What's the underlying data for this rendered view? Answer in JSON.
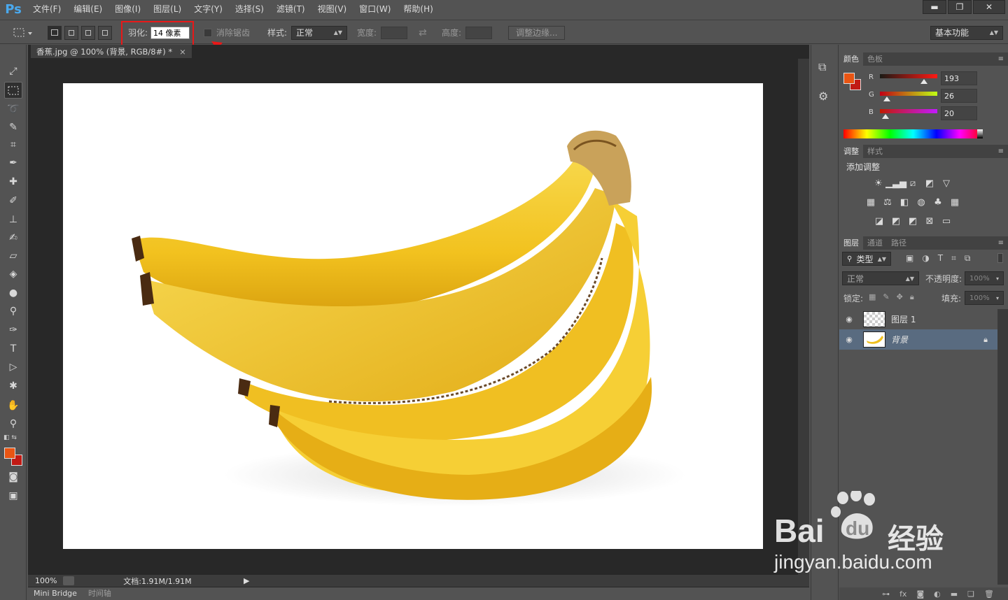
{
  "app": {
    "logo": "Ps"
  },
  "menu": [
    "文件(F)",
    "编辑(E)",
    "图像(I)",
    "图层(L)",
    "文字(Y)",
    "选择(S)",
    "滤镜(T)",
    "视图(V)",
    "窗口(W)",
    "帮助(H)"
  ],
  "window_controls": {
    "minimize": "▬",
    "restore": "❐",
    "close": "✕"
  },
  "options": {
    "feather_label": "羽化:",
    "feather_value": "14 像素",
    "antialias_label": "消除锯齿",
    "style_label": "样式:",
    "style_value": "正常",
    "width_label": "宽度:",
    "height_label": "高度:",
    "refine_edge": "调整边缘...",
    "workspace": "基本功能"
  },
  "document": {
    "tab_title": "香蕉.jpg @ 100% (背景, RGB/8#) *",
    "tab_close": "×",
    "zoom": "100%",
    "doc_info": "文档:1.91M/1.91M"
  },
  "bottom_tabs": [
    "Mini Bridge",
    "时间轴"
  ],
  "color_panel": {
    "tabs": [
      "颜色",
      "色板"
    ],
    "channels": [
      {
        "label": "R",
        "value": "193"
      },
      {
        "label": "G",
        "value": "26"
      },
      {
        "label": "B",
        "value": "20"
      }
    ],
    "foreground": "#c11a14",
    "background": "#e95513"
  },
  "adjust_panel": {
    "tabs": [
      "调整",
      "样式"
    ],
    "title": "添加调整"
  },
  "layers_panel": {
    "tabs": [
      "图层",
      "通道",
      "路径"
    ],
    "filter_label": "类型",
    "blend_mode": "正常",
    "opacity_label": "不透明度:",
    "opacity_value": "100%",
    "lock_label": "锁定:",
    "fill_label": "填充:",
    "fill_value": "100%",
    "layers": [
      {
        "name": "图层 1"
      },
      {
        "name": "背景"
      }
    ]
  },
  "watermark": {
    "brand": "Bai",
    "brand2": "du",
    "cn": "经验",
    "url": "jingyan.baidu.com"
  }
}
